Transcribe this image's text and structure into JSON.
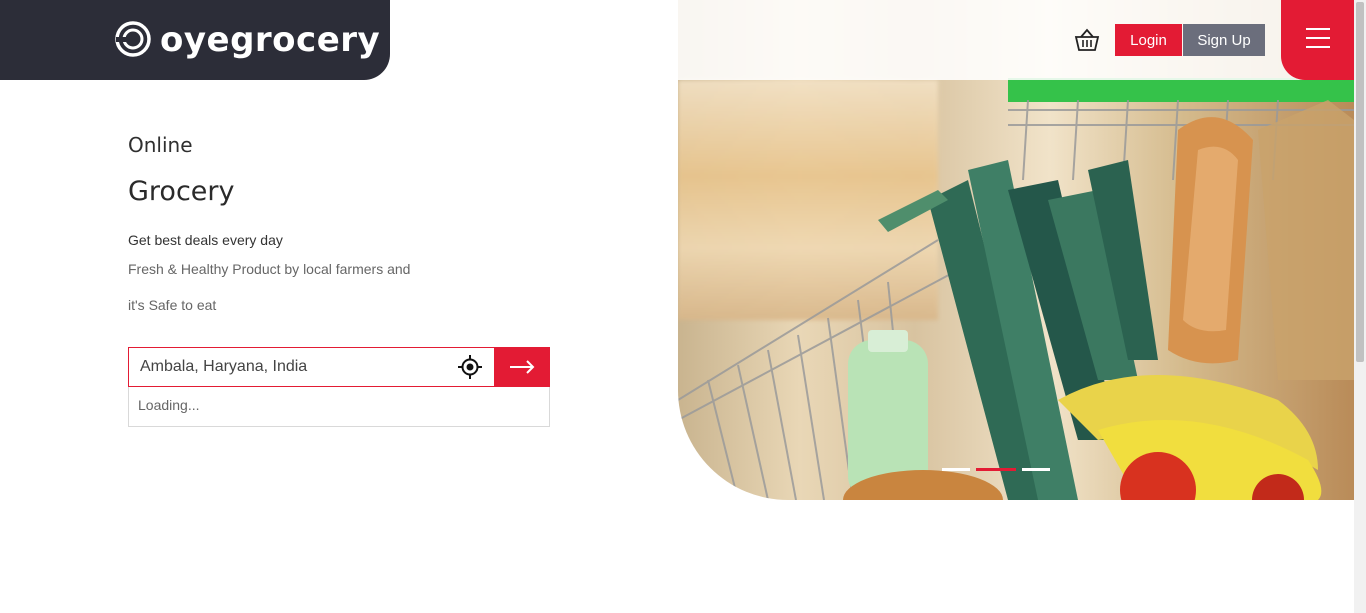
{
  "brand": {
    "name": "oyegrocery",
    "icon": "oyegrocery-logo-icon"
  },
  "header": {
    "cart_icon": "shopping-basket-icon",
    "login_label": "Login",
    "signup_label": "Sign Up",
    "menu_icon": "hamburger-menu-icon"
  },
  "hero": {
    "eyebrow": "Online",
    "headline": "Grocery",
    "tagline": "Get best deals every day",
    "description_line1": "Fresh & Healthy Product by local farmers and",
    "description_line2": "it's Safe to eat",
    "slider": {
      "slides": 3,
      "active_index": 1
    }
  },
  "search": {
    "value": "Ambala, Haryana, India",
    "locate_icon": "crosshair-locate-icon",
    "submit_icon": "arrow-right-icon",
    "dropdown_text": "Loading..."
  },
  "colors": {
    "accent": "#e31b34",
    "dark": "#2c2d38",
    "secondary_button": "#6b6e7c"
  }
}
